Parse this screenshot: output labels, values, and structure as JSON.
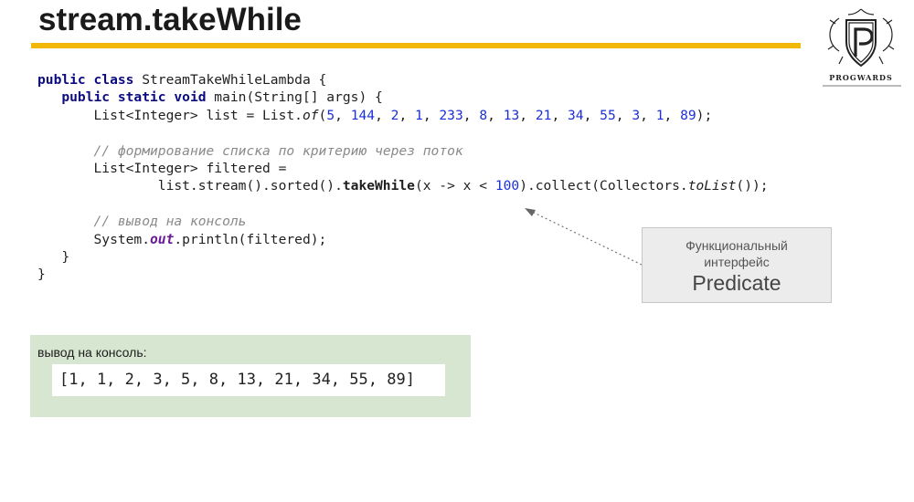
{
  "slide": {
    "title": "stream.takeWhile"
  },
  "logo": {
    "text": "PROGWARDS",
    "icon": "shield-p-logo-icon"
  },
  "code": {
    "l1": {
      "kw1": "public class",
      "rest": " StreamTakeWhileLambda {"
    },
    "l2": {
      "indent": "   ",
      "kw": "public static void",
      "rest": " main(String[] args) {"
    },
    "l3": {
      "prefix": "       List<Integer> list = List.",
      "method": "of",
      "open": "(",
      "nums": [
        "5",
        "144",
        "2",
        "1",
        "233",
        "8",
        "13",
        "21",
        "34",
        "55",
        "3",
        "1",
        "89"
      ],
      "close": ");"
    },
    "l5": {
      "indent": "       ",
      "comment": "// формирование списка по критерию через поток"
    },
    "l6": {
      "text": "       List<Integer> filtered ="
    },
    "l7": {
      "prefix": "               list.stream().sorted().",
      "method": "takeWhile",
      "mid": "(x -> x < ",
      "num": "100",
      "mid2": ").collect(Collectors.",
      "method2": "toList",
      "close": "());"
    },
    "l9": {
      "indent": "       ",
      "comment": "// вывод на консоль"
    },
    "l10": {
      "prefix": "       System.",
      "field": "out",
      "rest": ".println(filtered);"
    },
    "l11": {
      "text": "   }"
    },
    "l12": {
      "text": "}"
    }
  },
  "callout": {
    "line1": "Функциональный",
    "line2": "интерфейс",
    "line3": "Predicate"
  },
  "output": {
    "label": "вывод на консоль:",
    "value": "[1, 1, 2, 3, 5, 8, 13, 21, 34, 55, 89]"
  }
}
